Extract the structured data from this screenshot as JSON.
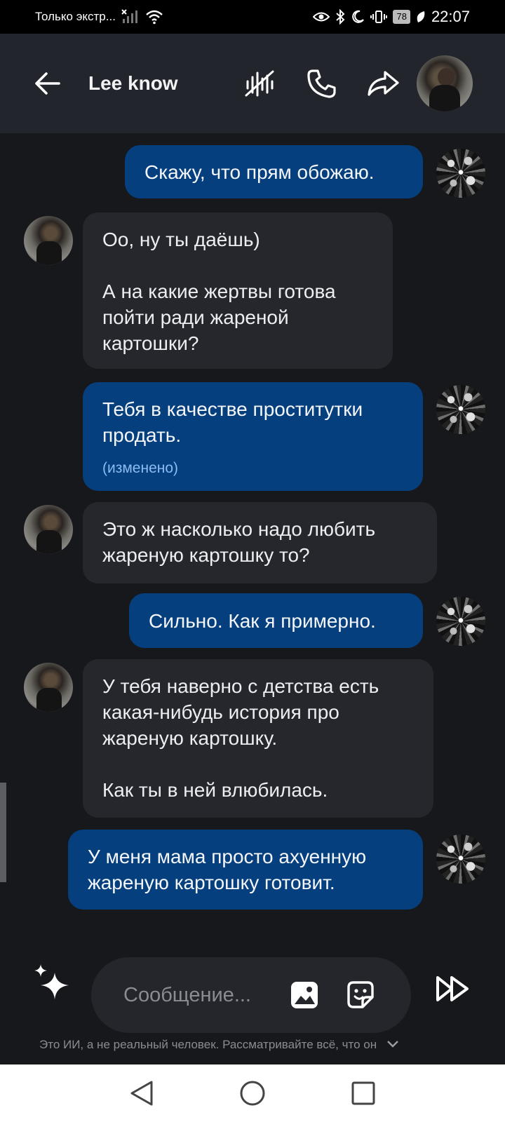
{
  "status_bar": {
    "carrier": "Только экстр...",
    "time": "22:07",
    "battery": "78"
  },
  "header": {
    "contact_name": "Lee know"
  },
  "messages": [
    {
      "role": "user",
      "text": "Скажу, что прям обожаю.",
      "edited": ""
    },
    {
      "role": "bot",
      "text": "Оо, ну ты даёшь)\n\nА на какие жертвы готова пойти ради жареной картошки?"
    },
    {
      "role": "user",
      "text": "Тебя в качестве проститутки продать.",
      "edited": "(изменено)"
    },
    {
      "role": "bot",
      "text": "Это ж насколько надо любить жареную картошку то?"
    },
    {
      "role": "user",
      "text": "Сильно. Как я примерно.",
      "edited": ""
    },
    {
      "role": "bot",
      "text": "У тебя наверно с детства есть какая-нибудь история про жареную картошку.\n\nКак ты в ней влюбилась."
    },
    {
      "role": "user",
      "text": "У меня мама просто ахуенную жареную картошку готовит.",
      "edited": ""
    }
  ],
  "composer": {
    "placeholder": "Сообщение...",
    "value": ""
  },
  "disclaimer": "Это ИИ, а не реальный человек. Рассматривайте всё, что он",
  "colors": {
    "user_bubble": "#053f7e",
    "bot_bubble": "#25272d",
    "background": "#17181c",
    "header": "#22252b",
    "edited_label": "#8bbcf3"
  }
}
